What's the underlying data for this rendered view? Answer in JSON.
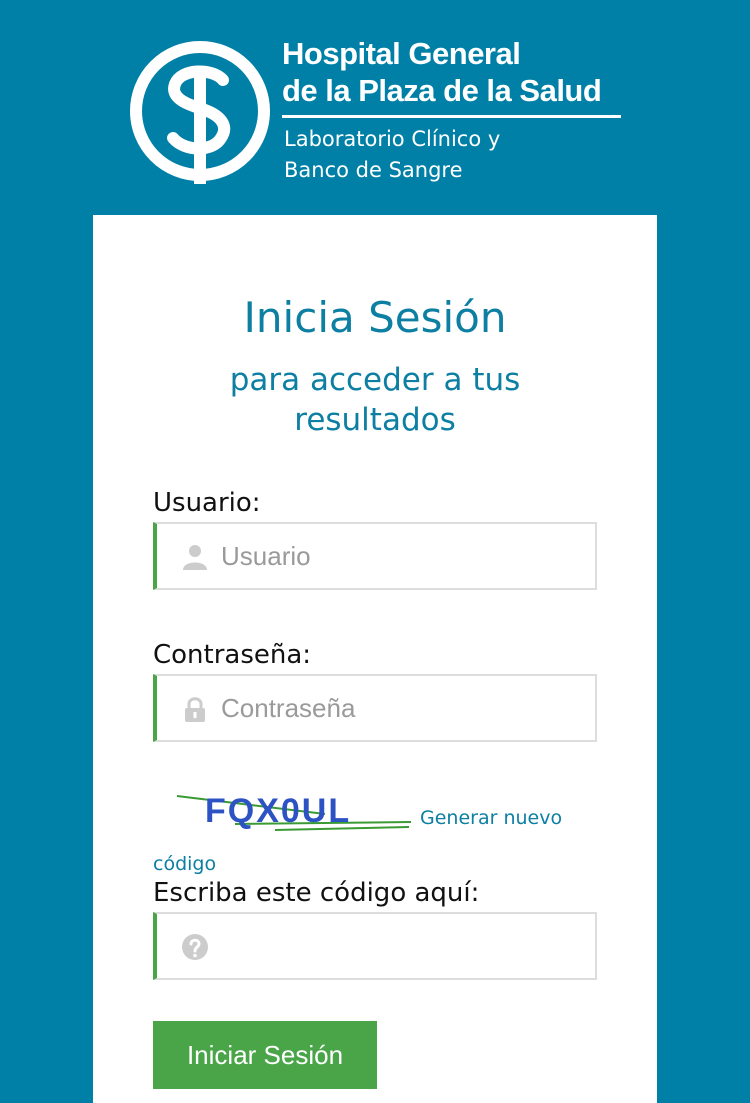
{
  "header": {
    "logo": "hospital-logo",
    "hospital_line_1": "Hospital General",
    "hospital_line_2": "de la Plaza de la Salud",
    "lab_line_1": "Laboratorio Clínico y",
    "lab_line_2": "Banco de Sangre"
  },
  "login": {
    "title": "Inicia Sesión",
    "subtitle": "para acceder a tus resultados",
    "username": {
      "label": "Usuario:",
      "placeholder": "Usuario",
      "value": "",
      "icon": "user-icon"
    },
    "password": {
      "label": "Contraseña:",
      "placeholder": "Contraseña",
      "value": "",
      "icon": "lock-icon"
    },
    "captcha": {
      "code": "FQX0UL",
      "regenerate_label": "Generar nuevo código",
      "label": "Escriba este código aquí:",
      "placeholder": "",
      "value": "",
      "icon": "question-icon"
    },
    "submit_label": "Iniciar Sesión"
  },
  "colors": {
    "background": "#0080a6",
    "accent_text": "#0c7fa3",
    "button": "#4aa548",
    "field_border_left": "#4aa548"
  }
}
